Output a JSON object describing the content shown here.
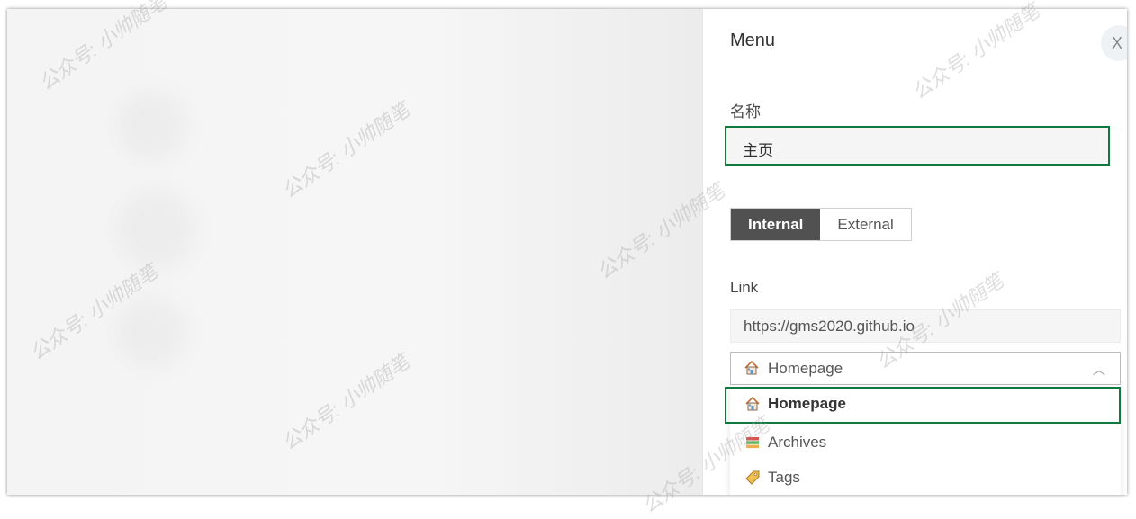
{
  "panel": {
    "title": "Menu",
    "close_label": "X"
  },
  "form": {
    "name_label": "名称",
    "name_value": "主页",
    "link_type": {
      "options": [
        "Internal",
        "External"
      ],
      "selected": "Internal"
    },
    "link_label": "Link",
    "link_value": "https://gms2020.github.io"
  },
  "select": {
    "value": "Homepage",
    "icon": "house-icon"
  },
  "dropdown": {
    "options": [
      {
        "label": "Homepage",
        "icon": "house-icon"
      },
      {
        "label": "Archives",
        "icon": "books-icon"
      },
      {
        "label": "Tags",
        "icon": "tag-icon"
      }
    ]
  },
  "watermark": "公众号: 小帅随笔",
  "colors": {
    "highlight": "#0e7a3e",
    "segment_active": "#515151"
  }
}
